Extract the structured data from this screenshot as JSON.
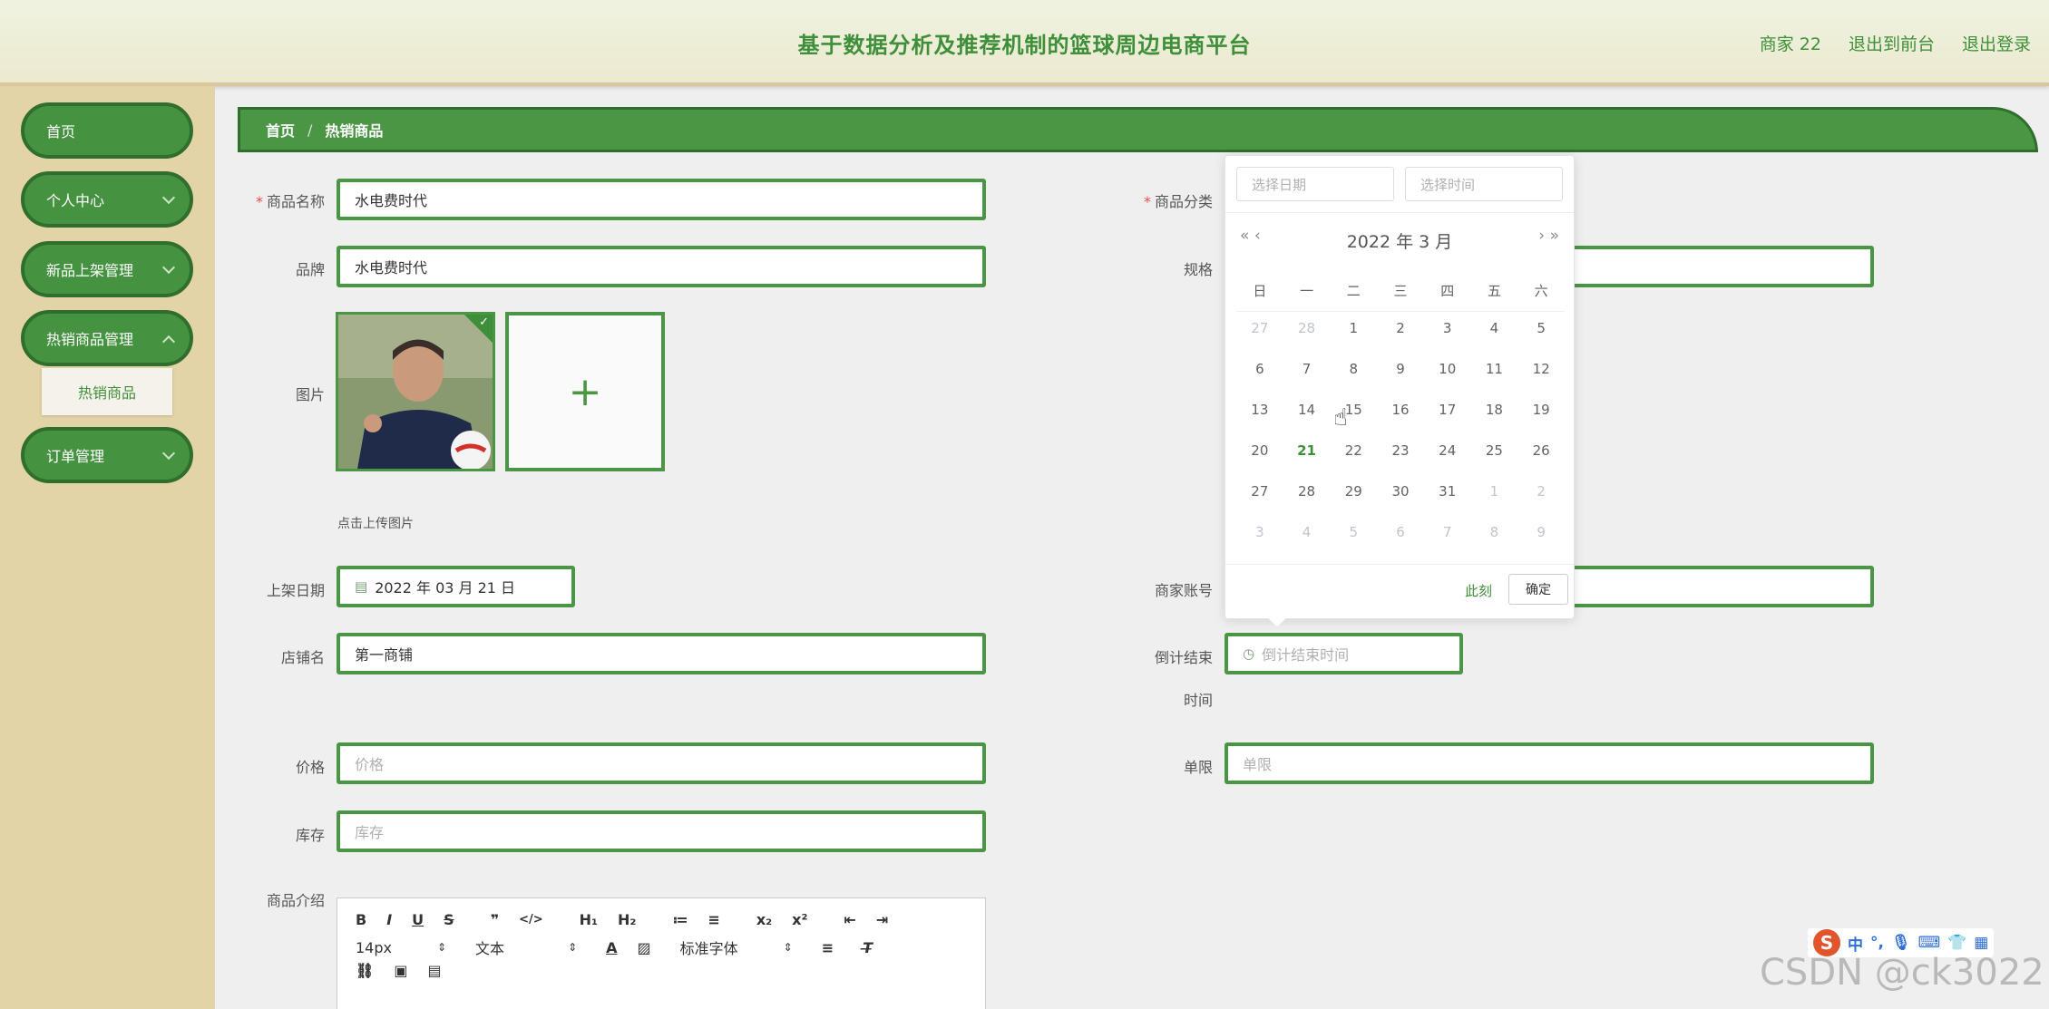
{
  "header": {
    "title": "基于数据分析及推荐机制的篮球周边电商平台",
    "user": "商家 22",
    "to_front": "退出到前台",
    "logout": "退出登录"
  },
  "sidebar": {
    "items": [
      {
        "label": "首页"
      },
      {
        "label": "个人中心"
      },
      {
        "label": "新品上架管理"
      },
      {
        "label": "热销商品管理"
      },
      {
        "label": "订单管理"
      }
    ],
    "sub_active": "热销商品"
  },
  "breadcrumb": {
    "home": "首页",
    "sep": "/",
    "current": "热销商品"
  },
  "form": {
    "name_label": "商品名称",
    "name_value": "水电费时代",
    "category_label": "商品分类",
    "brand_label": "品牌",
    "brand_value": "水电费时代",
    "spec_label": "规格",
    "image_label": "图片",
    "upload_plus": "+",
    "upload_hint": "点击上传图片",
    "check": "✓",
    "date_label": "上架日期",
    "date_value": "2022 年 03 月 21 日",
    "merchant_label": "商家账号",
    "shop_label": "店铺名",
    "shop_value": "第一商铺",
    "countdown_label_1": "倒计结束",
    "countdown_label_2": "时间",
    "countdown_placeholder": "倒计结束时间",
    "price_label": "价格",
    "price_placeholder": "价格",
    "limit_label": "单限",
    "limit_placeholder": "单限",
    "stock_label": "库存",
    "stock_placeholder": "库存",
    "intro_label": "商品介绍",
    "required_mark": "*"
  },
  "editor": {
    "row1": [
      "B",
      "I",
      "U",
      "S",
      "❞",
      "</>",
      "H₁",
      "H₂",
      "≔",
      "≡",
      "x₂",
      "x²",
      "⇤",
      "⇥"
    ],
    "font_size": "14px",
    "text_style": "文本",
    "font_family": "标准字体",
    "caret": "⇕"
  },
  "picker": {
    "date_placeholder": "选择日期",
    "time_placeholder": "选择时间",
    "month_title": "2022 年  3 月",
    "prev_year": "«",
    "prev_month": "‹",
    "next_month": "›",
    "next_year": "»",
    "weekdays": [
      "日",
      "一",
      "二",
      "三",
      "四",
      "五",
      "六"
    ],
    "days": [
      {
        "d": "27",
        "t": "other"
      },
      {
        "d": "28",
        "t": "other"
      },
      {
        "d": "1"
      },
      {
        "d": "2"
      },
      {
        "d": "3"
      },
      {
        "d": "4"
      },
      {
        "d": "5"
      },
      {
        "d": "6"
      },
      {
        "d": "7"
      },
      {
        "d": "8"
      },
      {
        "d": "9"
      },
      {
        "d": "10"
      },
      {
        "d": "11"
      },
      {
        "d": "12"
      },
      {
        "d": "13"
      },
      {
        "d": "14"
      },
      {
        "d": "15"
      },
      {
        "d": "16"
      },
      {
        "d": "17"
      },
      {
        "d": "18"
      },
      {
        "d": "19"
      },
      {
        "d": "20"
      },
      {
        "d": "21",
        "t": "today"
      },
      {
        "d": "22"
      },
      {
        "d": "23"
      },
      {
        "d": "24"
      },
      {
        "d": "25"
      },
      {
        "d": "26"
      },
      {
        "d": "27"
      },
      {
        "d": "28"
      },
      {
        "d": "29"
      },
      {
        "d": "30"
      },
      {
        "d": "31"
      },
      {
        "d": "1",
        "t": "other"
      },
      {
        "d": "2",
        "t": "other"
      },
      {
        "d": "3",
        "t": "other"
      },
      {
        "d": "4",
        "t": "other"
      },
      {
        "d": "5",
        "t": "other"
      },
      {
        "d": "6",
        "t": "other"
      },
      {
        "d": "7",
        "t": "other"
      },
      {
        "d": "8",
        "t": "other"
      },
      {
        "d": "9",
        "t": "other"
      }
    ],
    "now": "此刻",
    "ok": "确定"
  },
  "ime": {
    "logo": "S",
    "mode": "中",
    "punct": "°,"
  },
  "watermark": "CSDN @ck3022",
  "colors": {
    "primary": "#4a9645",
    "dark": "#2f6e2c",
    "sidebar": "#e2d4a6"
  }
}
